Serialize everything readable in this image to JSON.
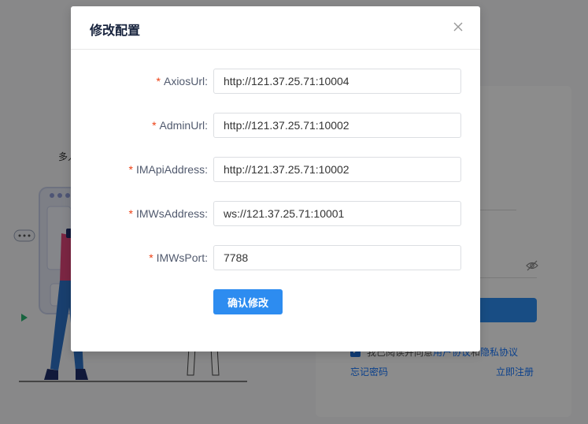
{
  "background": {
    "tagline": "多人",
    "agreement": {
      "prefix": "我已阅读并同意",
      "user_agreement": "用户协议",
      "and": "和",
      "privacy_policy": "隐私协议"
    },
    "forgot_password": "忘记密码",
    "register": "立即注册"
  },
  "modal": {
    "title": "修改配置",
    "close_icon": "close-icon",
    "fields": [
      {
        "label": "AxiosUrl",
        "required": "*",
        "value": "http://121.37.25.71:10004"
      },
      {
        "label": "AdminUrl",
        "required": "*",
        "value": "http://121.37.25.71:10002"
      },
      {
        "label": "IMApiAddress",
        "required": "*",
        "value": "http://121.37.25.71:10002"
      },
      {
        "label": "IMWsAddress",
        "required": "*",
        "value": "ws://121.37.25.71:10001"
      },
      {
        "label": "IMWsPort",
        "required": "*",
        "value": "7788"
      }
    ],
    "label_suffix": ":",
    "confirm_label": "确认修改"
  },
  "colors": {
    "primary": "#2d8cf0",
    "required_star": "#ed4014",
    "link": "#1677ff"
  }
}
